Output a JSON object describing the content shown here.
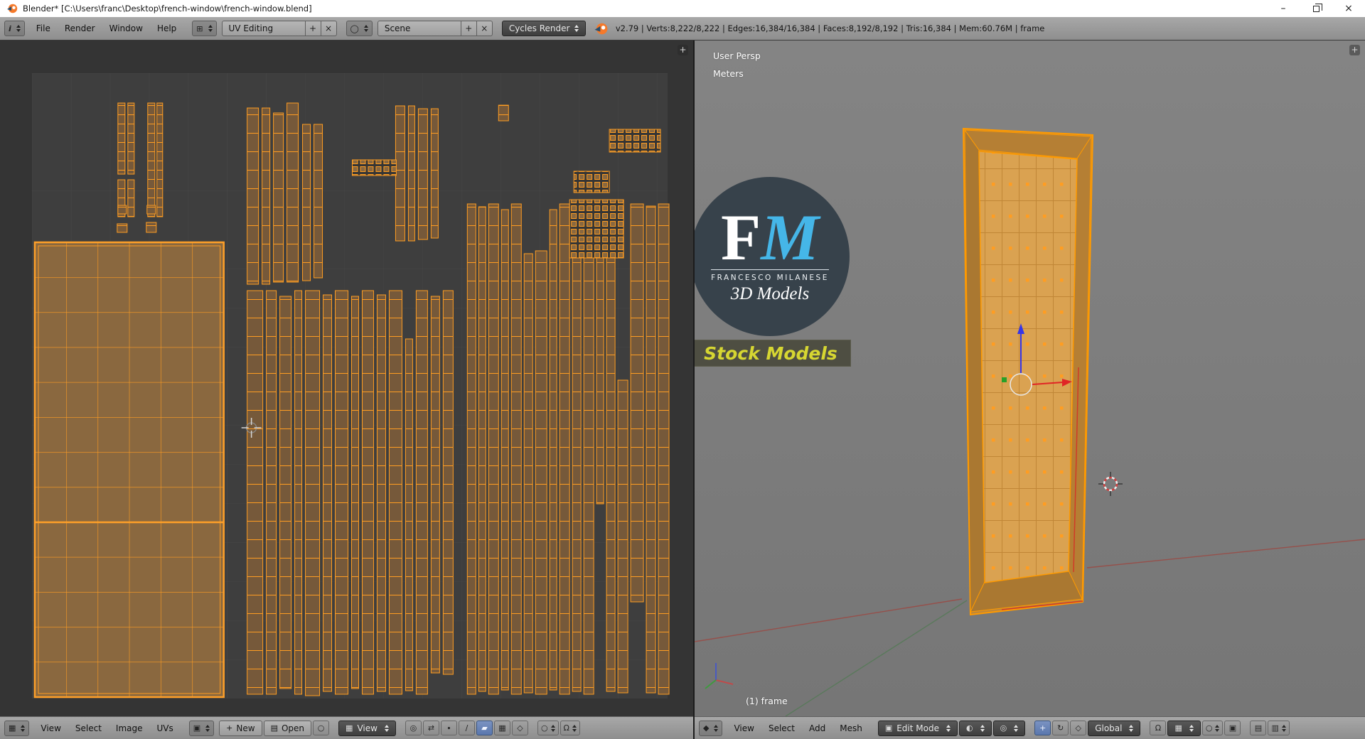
{
  "titlebar": {
    "title": "Blender* [C:\\Users\\franc\\Desktop\\french-window\\french-window.blend]",
    "minimize": "–",
    "close": "×"
  },
  "info_header": {
    "menus": [
      "File",
      "Render",
      "Window",
      "Help"
    ],
    "layout": "UV Editing",
    "scene": "Scene",
    "engine": "Cycles Render",
    "stats": "v2.79 | Verts:8,222/8,222 | Edges:16,384/16,384 | Faces:8,192/8,192 | Tris:16,384 | Mem:60.76M | frame"
  },
  "uv_editor": {
    "menus": [
      "View",
      "Select",
      "Image",
      "UVs"
    ],
    "new_label": "New",
    "open_label": "Open",
    "view_dropdown": "View"
  },
  "viewport_3d": {
    "persp": "User Persp",
    "units": "Meters",
    "frame": "(1) frame",
    "menus": [
      "View",
      "Select",
      "Add",
      "Mesh"
    ],
    "mode": "Edit Mode",
    "orientation": "Global",
    "watermark": {
      "f": "F",
      "m": "M",
      "name": "FRANCESCO MILANESE",
      "tagline": "3D Models",
      "stock": "Stock Models"
    }
  },
  "icons": {
    "info": "i",
    "plus": "+",
    "close_x": "×",
    "window_layout": "⊞",
    "scene": "◯",
    "grid": "▦",
    "image": "▣",
    "folder": "▤",
    "pin": "○",
    "cursor": "◎",
    "sync": "⇄",
    "vertex": "∙",
    "edge": "∕",
    "face": "▰",
    "island": "▦",
    "sticky": "◇",
    "proportional": "○",
    "magnet": "Ω",
    "cube": "▣",
    "sphere": "◐",
    "pivot": "◎",
    "translate": "+",
    "rotate": "↻",
    "scale": "◇",
    "snap_element": "▦",
    "render_still": "▤",
    "render_anim": "▥",
    "editor_3d": "◆"
  },
  "colors": {
    "selection_orange": "#ff9a00",
    "face_fill_brown": "#8a683f",
    "logo_blue": "#45b6e8",
    "stock_yellow": "#d6d632",
    "header_gray": "#9a9a9a",
    "uv_background": "#3a3a3a",
    "viewport_background": "#7d7d7d"
  }
}
